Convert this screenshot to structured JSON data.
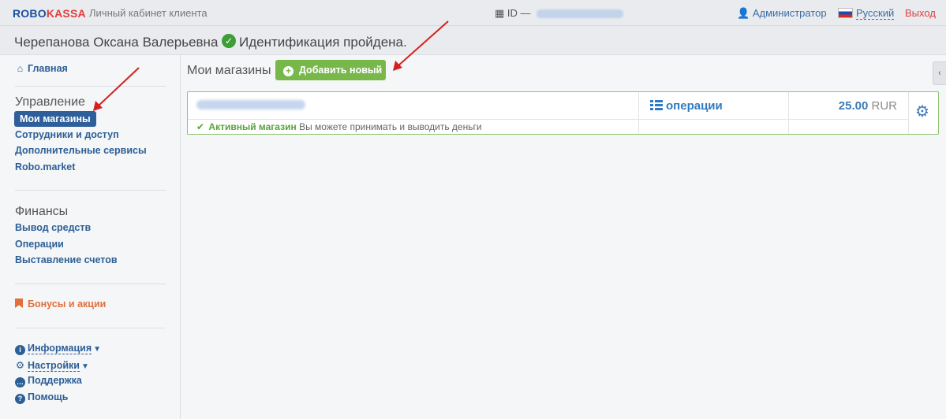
{
  "header": {
    "logo_robo": "ROBO",
    "logo_kassa": "KASSA",
    "cabinet_title": "Личный кабинет клиента",
    "id_label": "ID —",
    "user_role": "Администратор",
    "language": "Русский",
    "logout": "Выход"
  },
  "user": {
    "full_name": "Черепанова Оксана Валерьевна",
    "verification": "Идентификация пройдена."
  },
  "sidebar": {
    "home": "Главная",
    "management_title": "Управление",
    "management_items": [
      "Мои магазины",
      "Сотрудники и доступ",
      "Дополнительные сервисы",
      "Robo.market"
    ],
    "finance_title": "Финансы",
    "finance_items": [
      "Вывод средств",
      "Операции",
      "Выставление счетов"
    ],
    "bonuses": "Бонусы и акции",
    "info": "Информация",
    "settings": "Настройки",
    "support": "Поддержка",
    "help": "Помощь"
  },
  "main": {
    "title": "Мои магазины",
    "add_button": "Добавить новый",
    "shop": {
      "operations": "операции",
      "balance": "25.00",
      "currency": "RUR",
      "status": "Активный магазин",
      "status_desc": "Вы можете принимать и выводить деньги"
    }
  },
  "icons": {
    "home": "home-icon",
    "verified": "check-circle-icon",
    "user": "user-icon",
    "building": "building-icon",
    "flag": "russia-flag-icon",
    "list": "list-icon",
    "gear": "gear-icon",
    "bonus": "bookmark-icon",
    "info": "info-icon",
    "settings": "cog-icon",
    "support": "chat-icon",
    "help": "question-icon"
  },
  "colors": {
    "brand_blue": "#1b4f9c",
    "brand_red": "#e33c3c",
    "active_bg": "#2f5f9a",
    "add_button": "#78b84a",
    "active_green": "#5ba23b",
    "annotation_arrow": "#d42020"
  }
}
